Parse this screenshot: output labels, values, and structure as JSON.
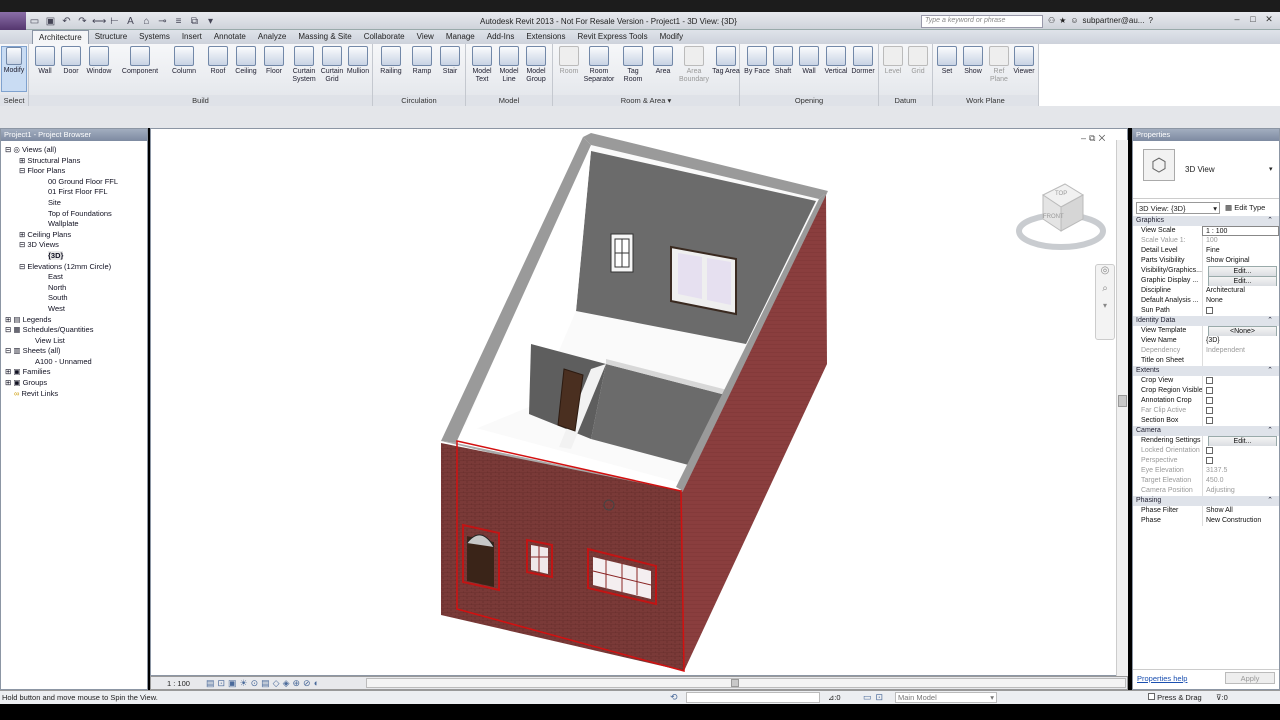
{
  "title": "Autodesk Revit 2013 - Not For Resale Version -    Project1 - 3D View: {3D}",
  "search_placeholder": "Type a keyword or phrase",
  "user": "subpartner@au...",
  "tabs": [
    "Architecture",
    "Structure",
    "Systems",
    "Insert",
    "Annotate",
    "Analyze",
    "Massing & Site",
    "Collaborate",
    "View",
    "Manage",
    "Add-Ins",
    "Extensions",
    "Revit Express Tools",
    "Modify"
  ],
  "ribbon": {
    "select": {
      "modify": "Modify",
      "label": "Select"
    },
    "build": {
      "label": "Build",
      "tools": [
        "Wall",
        "Door",
        "Window",
        "Component",
        "Column",
        "Roof",
        "Ceiling",
        "Floor",
        "Curtain System",
        "Curtain Grid",
        "Mullion"
      ]
    },
    "circulation": {
      "label": "Circulation",
      "tools": [
        "Railing",
        "Ramp",
        "Stair"
      ]
    },
    "model": {
      "label": "Model",
      "tools": [
        "Model Text",
        "Model Line",
        "Model Group"
      ]
    },
    "room_area": {
      "label": "Room & Area",
      "tools": [
        "Room",
        "Room Separator",
        "Tag Room",
        "Area",
        "Area Boundary",
        "Tag Area"
      ]
    },
    "opening": {
      "label": "Opening",
      "tools": [
        "By Face",
        "Shaft",
        "Wall",
        "Vertical",
        "Dormer"
      ]
    },
    "datum": {
      "label": "Datum",
      "tools": [
        "Level",
        "Grid"
      ]
    },
    "work_plane": {
      "label": "Work Plane",
      "tools": [
        "Set",
        "Show",
        "Ref Plane",
        "Viewer"
      ]
    }
  },
  "project_browser": {
    "title": "Project1 - Project Browser",
    "items": [
      "Views (all)",
      "Structural Plans",
      "Floor Plans",
      "00 Ground Floor FFL",
      "01 First Floor FFL",
      "Site",
      "Top of Foundations",
      "Wallplate",
      "Ceiling Plans",
      "3D Views",
      "{3D}",
      "Elevations (12mm Circle)",
      "East",
      "North",
      "South",
      "West",
      "Legends",
      "Schedules/Quantities",
      "View List",
      "Sheets (all)",
      "A100 - Unnamed",
      "Families",
      "Groups",
      "Revit Links"
    ]
  },
  "viewcube": {
    "top": "TOP",
    "front": "FRONT"
  },
  "view_scale": "1 : 100",
  "properties": {
    "title": "Properties",
    "type_name": "3D View",
    "selector": "3D View: {3D}",
    "edit_type": "Edit Type",
    "graphics": {
      "label": "Graphics",
      "view_scale": "View Scale",
      "view_scale_v": "1 : 100",
      "scale_value": "Scale Value    1:",
      "scale_value_v": "100",
      "detail_level": "Detail Level",
      "detail_level_v": "Fine",
      "parts_visibility": "Parts Visibility",
      "parts_visibility_v": "Show Original",
      "vg": "Visibility/Graphics...",
      "gdo": "Graphic Display ...",
      "edit": "Edit...",
      "discipline": "Discipline",
      "discipline_v": "Architectural",
      "default_analysis": "Default Analysis ...",
      "default_analysis_v": "None",
      "sun_path": "Sun Path"
    },
    "identity": {
      "label": "Identity Data",
      "view_template": "View Template",
      "view_template_v": "<None>",
      "view_name": "View Name",
      "view_name_v": "{3D}",
      "dependency": "Dependency",
      "dependency_v": "Independent",
      "title_on_sheet": "Title on Sheet"
    },
    "extents": {
      "label": "Extents",
      "crop_view": "Crop View",
      "crop_region_visible": "Crop Region Visible",
      "annotation_crop": "Annotation Crop",
      "far_clip_active": "Far Clip Active",
      "section_box": "Section Box"
    },
    "camera": {
      "label": "Camera",
      "rendering_settings": "Rendering Settings",
      "locked_orientation": "Locked Orientation",
      "perspective": "Perspective",
      "eye_elevation": "Eye Elevation",
      "eye_elevation_v": "3137.5",
      "target_elevation": "Target Elevation",
      "target_elevation_v": "450.0",
      "camera_position": "Camera Position",
      "camera_position_v": "Adjusting"
    },
    "phasing": {
      "label": "Phasing",
      "phase_filter": "Phase Filter",
      "phase_filter_v": "Show All",
      "phase": "Phase",
      "phase_v": "New Construction"
    },
    "help": "Properties help",
    "apply": "Apply"
  },
  "status": {
    "message": "Hold button and move mouse to Spin the View.",
    "counter": ":0",
    "model": "Main Model",
    "press_drag": "Press & Drag",
    "filter_count": ":0"
  }
}
